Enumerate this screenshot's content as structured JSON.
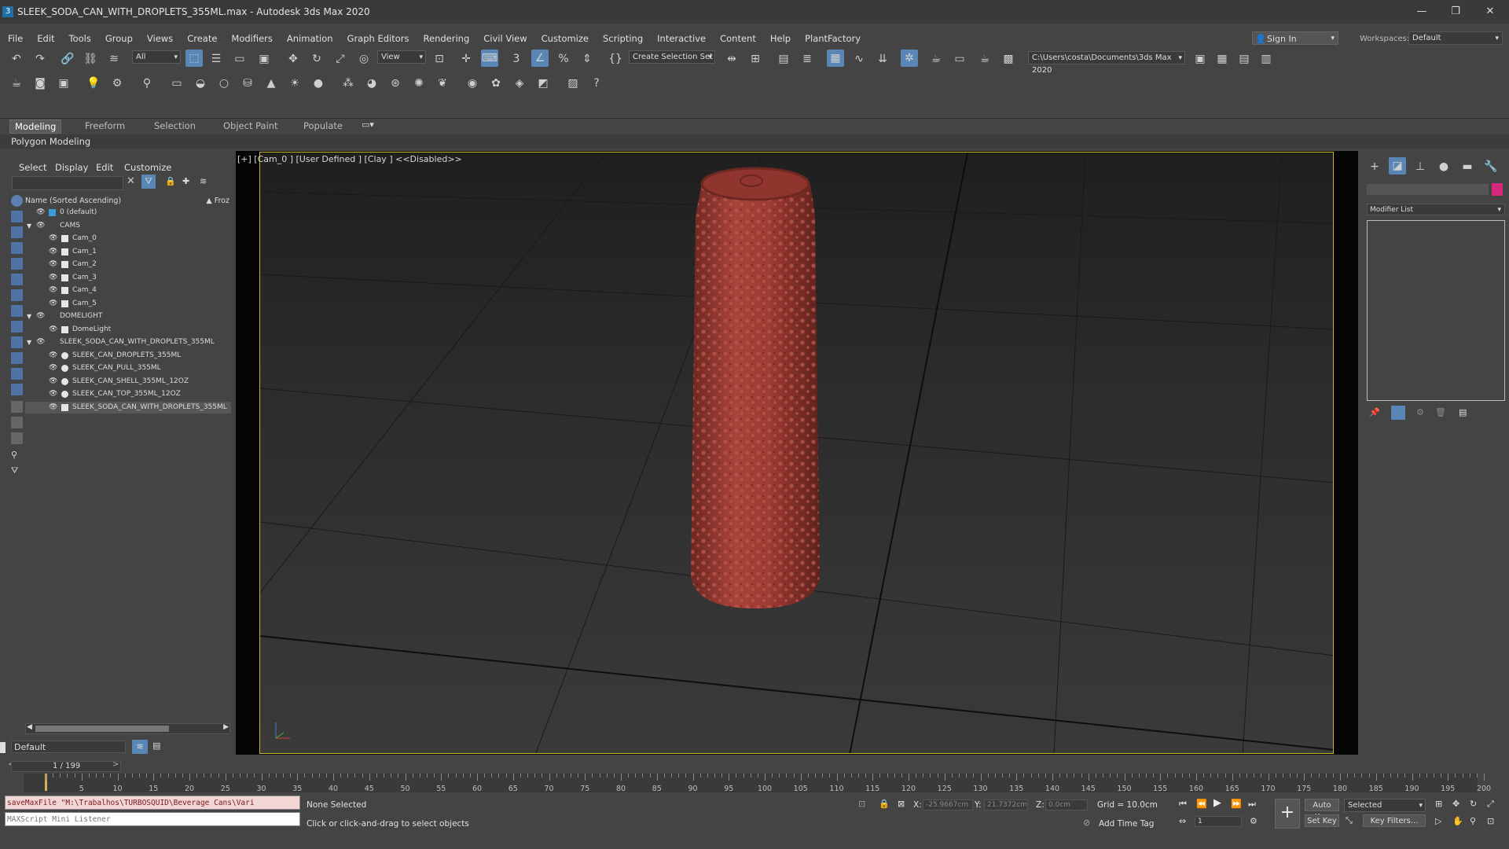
{
  "window": {
    "title": "SLEEK_SODA_CAN_WITH_DROPLETS_355ML.max - Autodesk 3ds Max 2020",
    "app_icon": "3",
    "controls": [
      "—",
      "❐",
      "✕"
    ]
  },
  "menubar": [
    "File",
    "Edit",
    "Tools",
    "Group",
    "Views",
    "Create",
    "Modifiers",
    "Animation",
    "Graph Editors",
    "Rendering",
    "Civil View",
    "Customize",
    "Scripting",
    "Interactive",
    "Content",
    "Help",
    "PlantFactory"
  ],
  "signin": {
    "label": "Sign In"
  },
  "workspace": {
    "label": "Workspaces:",
    "value": "Default"
  },
  "toolbar": {
    "filter_value": "All",
    "view_value": "View",
    "selection_set_label": "Create Selection Set",
    "path_value": "C:\\Users\\costa\\Documents\\3ds Max 2020"
  },
  "ribbon": {
    "tabs": [
      "Modeling",
      "Freeform",
      "Selection",
      "Object Paint",
      "Populate"
    ],
    "active": "Modeling",
    "panel_label": "Polygon Modeling"
  },
  "explorer": {
    "menu": [
      "Select",
      "Display",
      "Edit",
      "Customize"
    ],
    "header": "Name (Sorted Ascending)",
    "header_right": "▲ Froz",
    "rows": [
      {
        "label": "0 (default)",
        "indent": 0,
        "type": "layer"
      },
      {
        "label": "CAMS",
        "indent": 0,
        "type": "group",
        "expand": true
      },
      {
        "label": "Cam_0",
        "indent": 1,
        "type": "camera"
      },
      {
        "label": "Cam_1",
        "indent": 1,
        "type": "camera"
      },
      {
        "label": "Cam_2",
        "indent": 1,
        "type": "camera"
      },
      {
        "label": "Cam_3",
        "indent": 1,
        "type": "camera"
      },
      {
        "label": "Cam_4",
        "indent": 1,
        "type": "camera"
      },
      {
        "label": "Cam_5",
        "indent": 1,
        "type": "camera"
      },
      {
        "label": "DOMELIGHT",
        "indent": 0,
        "type": "group",
        "expand": true
      },
      {
        "label": "DomeLight",
        "indent": 1,
        "type": "light"
      },
      {
        "label": "SLEEK_SODA_CAN_WITH_DROPLETS_355ML",
        "indent": 0,
        "type": "group",
        "expand": true
      },
      {
        "label": "SLEEK_CAN_DROPLETS_355ML",
        "indent": 1,
        "type": "mesh"
      },
      {
        "label": "SLEEK_CAN_PULL_355ML",
        "indent": 1,
        "type": "mesh"
      },
      {
        "label": "SLEEK_CAN_SHELL_355ML_12OZ",
        "indent": 1,
        "type": "mesh"
      },
      {
        "label": "SLEEK_CAN_TOP_355ML_12OZ",
        "indent": 1,
        "type": "mesh"
      },
      {
        "label": "SLEEK_SODA_CAN_WITH_DROPLETS_355ML",
        "indent": 1,
        "type": "helper",
        "selected": true
      }
    ],
    "layer_value": "Default"
  },
  "viewport": {
    "label": "[+] [Cam_0 ] [User Defined ] [Clay ]  <<Disabled>>",
    "border_color": "#c8b42a",
    "object_color": "#9e3b33"
  },
  "command_panel": {
    "modifier_list": "Modifier List",
    "swatch_color": "#d6287e"
  },
  "timeline": {
    "frame_display": "1 / 199",
    "labels": [
      5,
      10,
      15,
      20,
      25,
      30,
      35,
      40,
      45,
      50,
      55,
      60,
      65,
      70,
      75,
      80,
      85,
      90,
      95,
      100,
      105,
      110,
      115,
      120,
      125,
      130,
      135,
      140,
      145,
      150,
      155,
      160,
      165,
      170,
      175,
      180,
      185,
      190,
      195,
      200
    ]
  },
  "status": {
    "maxscript_line": "saveMaxFile \"M:\\Trabalhos\\TURBOSQUID\\Beverage Cans\\Vari",
    "maxscript_placeholder": "MAXScript Mini Listener",
    "selection": "None Selected",
    "prompt": "Click or click-and-drag to select objects",
    "x_label": "X:",
    "x_value": "-25.9667cm",
    "y_label": "Y:",
    "y_value": "21.7372cm",
    "z_label": "Z:",
    "z_value": "0.0cm",
    "grid": "Grid = 10.0cm",
    "add_time_tag": "Add Time Tag",
    "auto_key": "Auto Key",
    "set_key": "Set Key",
    "selected_value": "Selected",
    "key_filters": "Key Filters...",
    "frame_value": "1"
  }
}
